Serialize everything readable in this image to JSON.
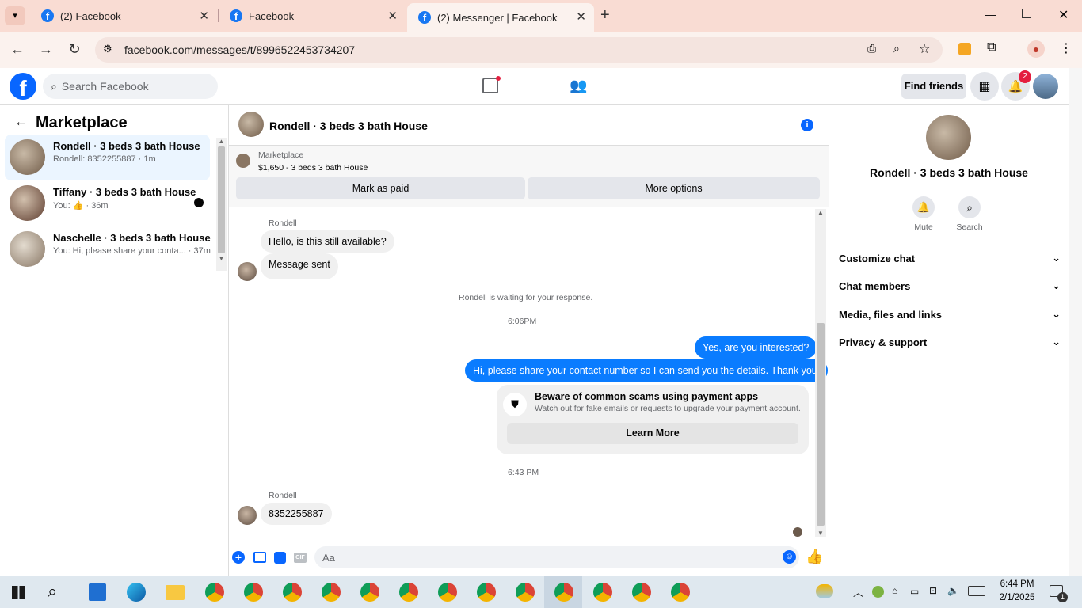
{
  "browser": {
    "tabs": [
      {
        "title": "(2) Facebook"
      },
      {
        "title": "Facebook"
      },
      {
        "title": "(2) Messenger | Facebook"
      }
    ],
    "url": "facebook.com/messages/t/8996522453734207"
  },
  "fb": {
    "search_placeholder": "Search Facebook",
    "find_friends": "Find friends",
    "notification_count": "2"
  },
  "sidebar": {
    "title": "Marketplace",
    "conversations": [
      {
        "name": "Rondell · 3 beds 3 bath House",
        "snippet": "Rondell: 8352255887 · 1m"
      },
      {
        "name": "Tiffany · 3 beds 3 bath House",
        "snippet_prefix": "You:",
        "snippet_suffix": "· 36m"
      },
      {
        "name": "Naschelle · 3 beds 3 bath House",
        "snippet": "You: Hi, please share your conta... · 37m"
      }
    ]
  },
  "chat": {
    "title": "Rondell · 3 beds 3 bath House",
    "listing_label": "Marketplace",
    "listing_detail": "$1,650 - 3 beds 3 bath House",
    "mark_paid": "Mark as paid",
    "more_options": "More options",
    "sender_name": "Rondell",
    "msg1": "Hello, is this still available?",
    "msg2": "Message sent",
    "waiting": "Rondell is waiting for your response.",
    "time1": "6:06PM",
    "out1": "Yes, are you interested?",
    "out2": "Hi, please share your contact number so I can send you the details. Thank you!",
    "scam_title": "Beware of common scams using payment apps",
    "scam_body": "Watch out for fake emails or requests to upgrade your payment account.",
    "learn_more": "Learn More",
    "time2": "6:43 PM",
    "msg3": "8352255887",
    "composer_placeholder": "Aa"
  },
  "info_panel": {
    "title": "Rondell · 3 beds 3 bath House",
    "mute": "Mute",
    "search": "Search",
    "sections": [
      "Customize chat",
      "Chat members",
      "Media, files and links",
      "Privacy & support"
    ]
  },
  "taskbar": {
    "time": "6:44 PM",
    "date": "2/1/2025",
    "notif_count": "1"
  },
  "colors": {
    "fb_blue": "#0866ff",
    "bubble_out": "#0a7cff",
    "tab_bg": "#f9dcd3"
  }
}
